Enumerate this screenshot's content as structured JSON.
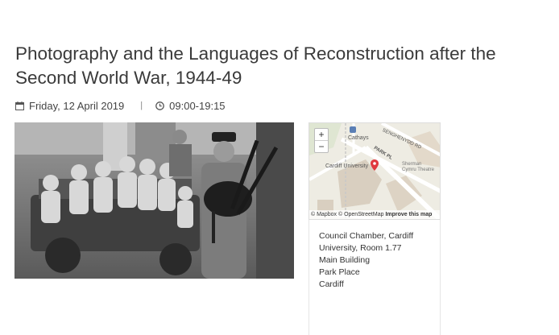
{
  "event": {
    "title_line1": "Photography and the Languages of Reconstruction after the",
    "title_line2": "Second World War, 1944-49",
    "date": "Friday, 12 April 2019",
    "separator": "|",
    "time": "09:00-19:15"
  },
  "icons": {
    "date": "calendar-icon",
    "time": "clock-icon"
  },
  "photo": {
    "description_visible": false
  },
  "map": {
    "zoom_in": "+",
    "zoom_out": "−",
    "labels": {
      "cathays": "Cathays",
      "cardiff_university": "Cardiff University",
      "park_pl": "PARK PL",
      "senghenydd": "SENGHENYDD RD",
      "sherman_line1": "Sherman",
      "sherman_line2": "Cymru Theatre"
    },
    "attribution": {
      "mapbox": "© Mapbox",
      "osm": "© OpenStreetMap",
      "improve": "Improve this map"
    },
    "colors": {
      "background": "#eeece3",
      "road": "#ffffff",
      "building": "#d9cfc0",
      "marker": "#e0393e"
    }
  },
  "address": {
    "lines": [
      "Council Chamber, Cardiff",
      "University, Room 1.77",
      "Main Building",
      "Park Place",
      "Cardiff"
    ]
  }
}
